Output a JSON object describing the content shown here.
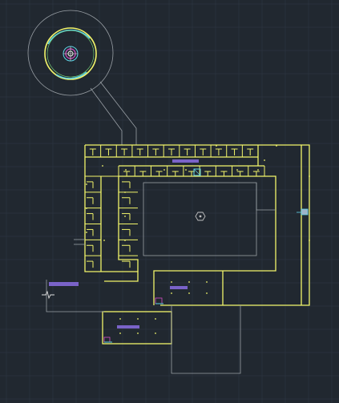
{
  "app": {
    "view": "model-space",
    "drawing": "floor-plan"
  },
  "colors": {
    "background": "#212830",
    "grid": "#2c3540",
    "grid_major": "#34404d",
    "walls": "#f2f56a",
    "outline": "#9aa0a6",
    "room_fill": "#7a63c8",
    "accent_cyan": "#5fd3e6",
    "accent_magenta": "#d64fc8",
    "accent_green": "#7de07d"
  },
  "icons": {
    "roundabout": "circle-plan-icon",
    "compass": "compass-rose-icon",
    "column_marker": "hexagon-marker-icon",
    "elevator": "elevator-block-icon",
    "stair": "stair-icon",
    "break_symbol": "break-line-icon"
  },
  "plan": {
    "north_wing_rooms": 11,
    "inner_row_rooms": 9,
    "west_rooms": 6,
    "inner_west_rooms": 6
  }
}
